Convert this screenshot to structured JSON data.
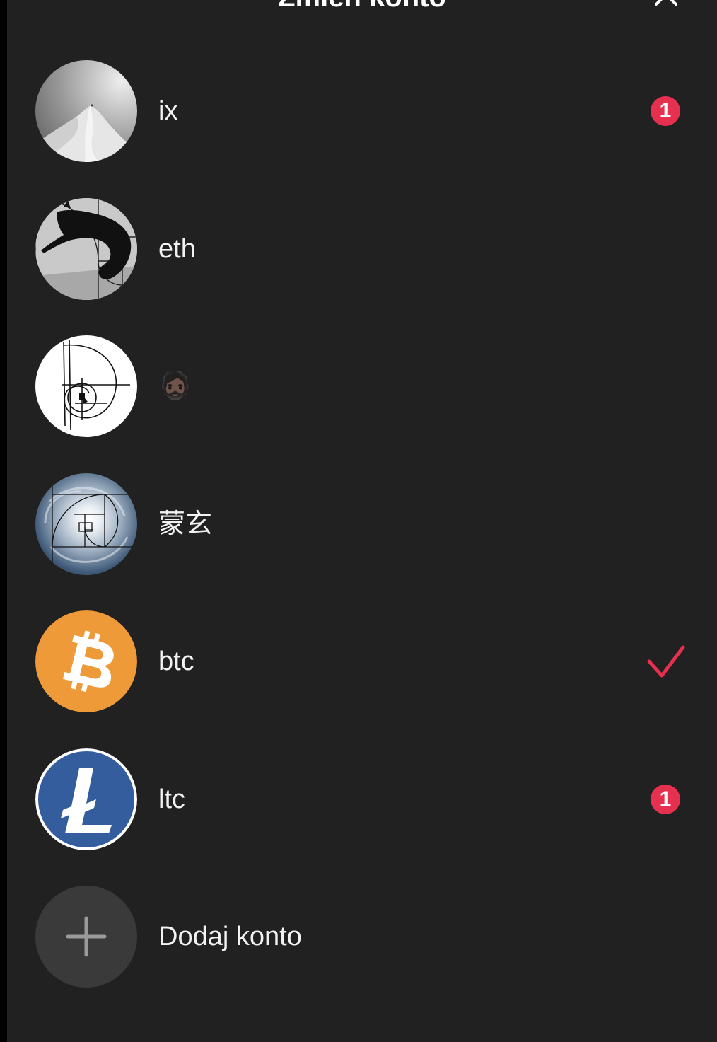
{
  "header": {
    "title": "Zmień konto",
    "close_icon": "close-icon"
  },
  "accounts": [
    {
      "name": "ix",
      "avatar": "snowy-mountain-photo",
      "badge": "1",
      "selected": false
    },
    {
      "name": "eth",
      "avatar": "cat-golden-spiral-photo",
      "badge": null,
      "selected": false
    },
    {
      "name": "🧔🏿",
      "avatar": "golden-spiral-sketch",
      "badge": null,
      "selected": false
    },
    {
      "name": "蒙玄",
      "avatar": "hurricane-golden-spiral-photo",
      "badge": null,
      "selected": false
    },
    {
      "name": "btc",
      "avatar": "bitcoin-logo",
      "badge": null,
      "selected": true
    },
    {
      "name": "ltc",
      "avatar": "litecoin-logo",
      "badge": "1",
      "selected": false
    }
  ],
  "add_account": {
    "label": "Dodaj konto",
    "icon": "plus-icon"
  },
  "colors": {
    "background": "#212121",
    "badge": "#e5304f",
    "checkmark": "#e5304f",
    "bitcoin": "#ee9a38",
    "litecoin": "#345d9d",
    "add_circle": "#3a3a3a"
  }
}
